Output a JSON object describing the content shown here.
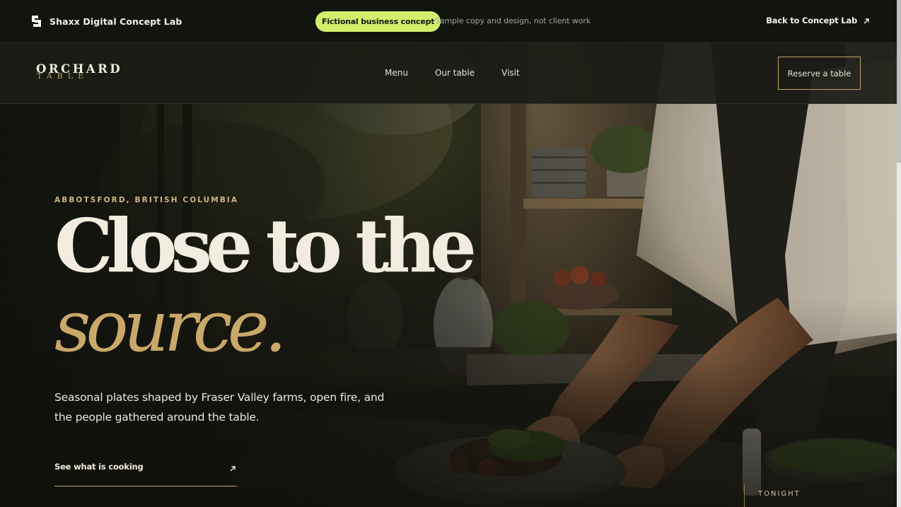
{
  "concept_bar": {
    "lab_name": "Shaxx Digital Concept Lab",
    "pill": "Fictional business concept",
    "note": "Sample copy and design, not client work",
    "back_link": "Back to Concept Lab",
    "pill_color": "#d2ef6c"
  },
  "nav": {
    "brand_top": "ORCHARD",
    "brand_bottom": "TABLE",
    "links": [
      "Menu",
      "Our table",
      "Visit"
    ],
    "reserve": "Reserve a table"
  },
  "hero": {
    "eyebrow": "ABBOTSFORD, BRITISH COLUMBIA",
    "headline_line1": "Close to the",
    "headline_line2": "source.",
    "lede": "Seasonal plates shaped by Fraser Valley farms, open fire, and the people gathered around the table.",
    "cta": "See what is cooking",
    "tonight": "TONIGHT"
  },
  "colors": {
    "accent_gold": "#c9a869",
    "cream": "#f1ecdf",
    "dark": "#141611"
  },
  "icons": [
    "lab-logo-icon",
    "arrow-up-right-icon"
  ]
}
